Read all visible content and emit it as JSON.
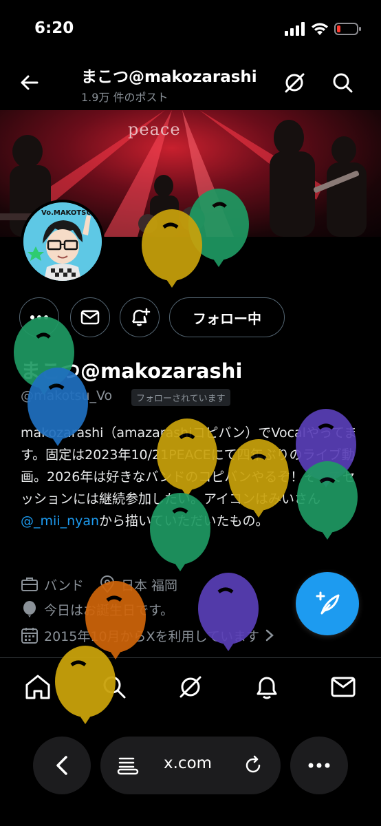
{
  "status": {
    "time": "6:20"
  },
  "header": {
    "title": "まこつ@makozarashi",
    "post_count": "1.9万 件のポスト",
    "back_icon": "arrow-left-icon",
    "grok_icon": "grok-icon",
    "search_icon": "search-icon"
  },
  "banner": {
    "venue_sign": "peace"
  },
  "avatar": {
    "caption": "Vo.MAKOTSU"
  },
  "actions": {
    "more_icon": "more-horizontal-icon",
    "message_icon": "envelope-icon",
    "notify_icon": "bell-plus-icon",
    "follow_label": "フォロー中"
  },
  "profile": {
    "display_name": "まこつ@makozarashi",
    "handle": "@makotsu_Vo",
    "follows_you": "フォローされています",
    "bio_text": "makozarashi（amazarashiコピバン）でVocalやってます。固定は2023年10/21PEACEにて四年ぶりのライブ動画。2026年は好きなバンドのコピバンやるぞ！そしてセッションには継続参加したい。アイコンはみいさん",
    "bio_mention": "@_mii_nyan",
    "bio_tail": "から描いていただいたもの。",
    "category": "バンド",
    "location": "日本 福岡",
    "birthday": "今日はお誕生日です。",
    "joined": "2015年10月からXを利用しています"
  },
  "colors": {
    "accent": "#1d9bf0",
    "muted": "#8b9299",
    "background": "#000000"
  },
  "fab": {
    "icon": "compose-post-icon"
  },
  "tabbar": {
    "home_icon": "home-icon",
    "search_icon": "search-icon",
    "grok_icon": "grok-icon",
    "notifications_icon": "bell-icon",
    "messages_icon": "envelope-icon"
  },
  "browser": {
    "url": "x.com",
    "back_icon": "chevron-left-icon",
    "reader_icon": "reader-icon",
    "reload_icon": "reload-icon",
    "more_icon": "more-horizontal-icon"
  }
}
